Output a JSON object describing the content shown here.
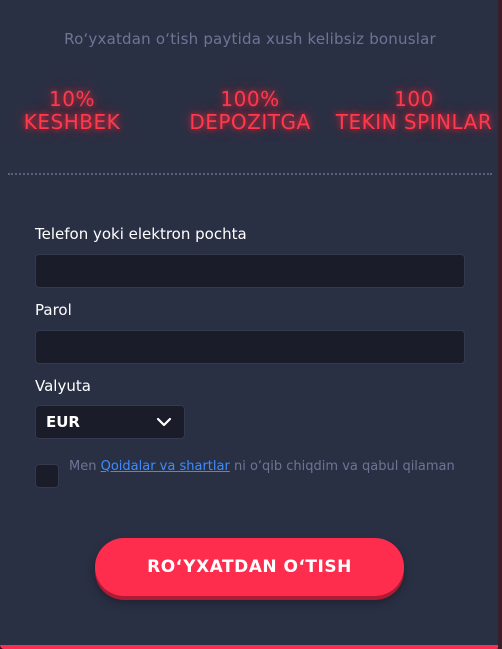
{
  "welcome_text": "Ro‘yxatdan o‘tish paytida xush kelibsiz bonuslar",
  "bonuses": [
    {
      "line1": "10%",
      "line2": "KESHBEK"
    },
    {
      "line1": "100%",
      "line2": "DEPOZITGA"
    },
    {
      "line1": "100",
      "line2": "TEKIN SPINLAR"
    }
  ],
  "form": {
    "login_label": "Telefon yoki elektron pochta",
    "login_value": "",
    "password_label": "Parol",
    "password_value": "",
    "currency_label": "Valyuta",
    "currency_value": "EUR",
    "terms_prefix": "Men",
    "terms_link": "Qoidalar va shartlar",
    "terms_suffix": "ni o‘qib chiqdim va qabul qilaman",
    "terms_checked": false,
    "submit_label": "RO‘YXATDAN O‘TISH"
  },
  "colors": {
    "panel_bg": "#2a3044",
    "bonus_red": "#ff3a4d",
    "button_red": "#ff2d4d",
    "link_blue": "#3d8cff"
  }
}
